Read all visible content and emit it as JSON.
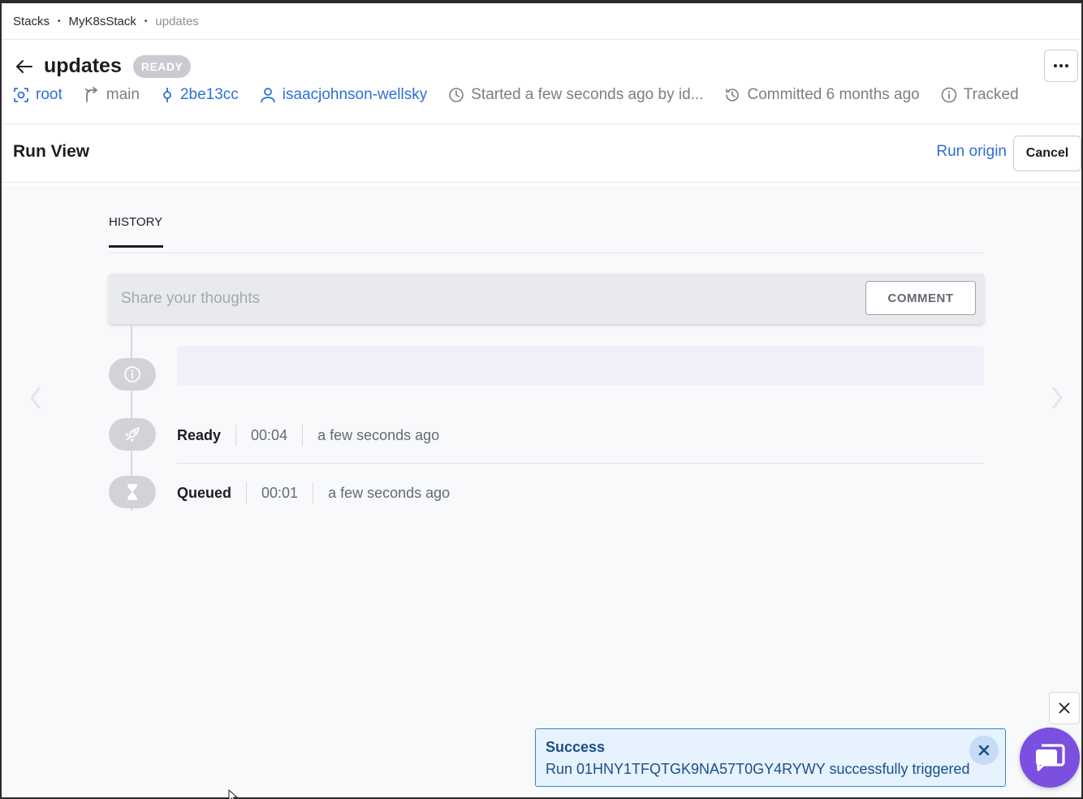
{
  "breadcrumb": {
    "items": [
      "Stacks",
      "MyK8sStack",
      "updates"
    ],
    "separator": "•"
  },
  "header": {
    "title": "updates",
    "status": "READY",
    "meta": {
      "project": "root",
      "branch": "main",
      "commit": "2be13cc",
      "user": "isaacjohnson-wellsky",
      "started": "Started a few seconds ago by id...",
      "committed": "Committed 6 months ago",
      "tracked": "Tracked"
    }
  },
  "runview": {
    "title": "Run View",
    "run_origin": "Run origin",
    "cancel": "Cancel"
  },
  "history": {
    "tab": "HISTORY",
    "comment_placeholder": "Share your thoughts",
    "comment_button": "COMMENT",
    "events": [
      {
        "label": "Ready",
        "duration": "00:04",
        "time": "a few seconds ago"
      },
      {
        "label": "Queued",
        "duration": "00:01",
        "time": "a few seconds ago"
      }
    ]
  },
  "toast": {
    "title": "Success",
    "message": "Run 01HNY1TFQTGK9NA57T0GY4RYWY successfully triggered"
  },
  "colors": {
    "accent": "#2e6fd8",
    "toast_bg": "#e6f2fd",
    "chat": "#7b4fe0",
    "badge": "#c9cbd0"
  }
}
